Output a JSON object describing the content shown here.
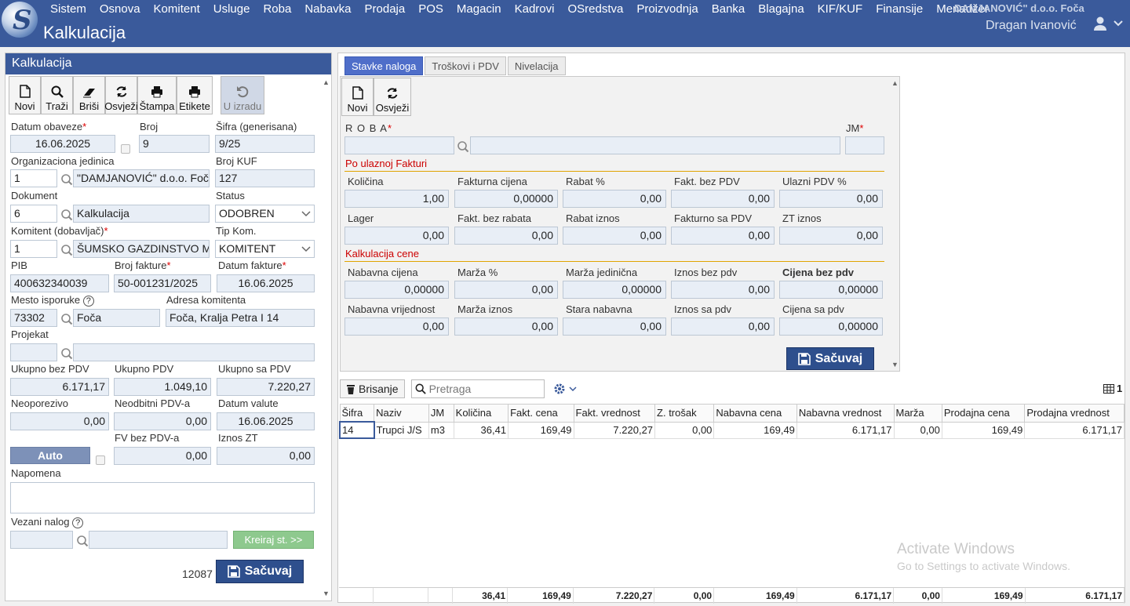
{
  "app": {
    "title": "Kalkulacija",
    "company": "DAMJANOVIĆ\" d.o.o. Foča",
    "user": "Dragan Ivanović"
  },
  "menu": [
    "Sistem",
    "Osnova",
    "Komitent",
    "Usluge",
    "Roba",
    "Nabavka",
    "Prodaja",
    "POS",
    "Magacin",
    "Kadrovi",
    "OSredstva",
    "Proizvodnja",
    "Banka",
    "Blagajna",
    "KIF/KUF",
    "Finansije",
    "Menadžer"
  ],
  "left": {
    "header": "Kalkulacija",
    "toolbar": {
      "novi": "Novi",
      "trazi": "Traži",
      "brisi": "Briši",
      "osvjezi": "Osvježi",
      "stampa": "Štampa",
      "etikete": "Etikete",
      "u_izradu": "U izradu"
    },
    "labels": {
      "datum_obaveze": "Datum obaveze",
      "broj": "Broj",
      "sifra": "Šifra (generisana)",
      "org": "Organizaciona jedinica",
      "broj_kuf": "Broj KUF",
      "dokument": "Dokument",
      "status": "Status",
      "komitent": "Komitent (dobavljač)",
      "tip_kom": "Tip Kom.",
      "pib": "PIB",
      "broj_fakture": "Broj fakture",
      "datum_fakture": "Datum fakture",
      "mesto": "Mesto isporuke",
      "adresa": "Adresa komitenta",
      "projekat": "Projekat",
      "ukupno_bez": "Ukupno bez PDV",
      "ukupno_pdv": "Ukupno PDV",
      "ukupno_sa": "Ukupno sa PDV",
      "neoporezivo": "Neoporezivo",
      "neodbitni": "Neodbitni PDV-a",
      "datum_valute": "Datum valute",
      "fv_bez": "FV bez PDV-a",
      "iznos_zt": "Iznos ZT",
      "napomena": "Napomena",
      "vezani": "Vezani nalog"
    },
    "values": {
      "datum_obaveze": "16.06.2025",
      "broj": "9",
      "sifra": "9/25",
      "org_code": "1",
      "org_name": "\"DAMJANOVIĆ\" d.o.o. Foča",
      "broj_kuf": "127",
      "dok_code": "6",
      "dok_name": "Kalkulacija",
      "status": "ODOBREN",
      "kom_code": "1",
      "kom_name": "ŠUMSKO GAZDINSTVO M",
      "tip_kom": "KOMITENT",
      "pib": "400632340039",
      "broj_fakture": "50-001231/2025",
      "datum_fakture": "16.06.2025",
      "mesto_code": "73302",
      "mesto_name": "Foča",
      "adresa": "Foča, Kralja Petra I 14",
      "ukupno_bez": "6.171,17",
      "ukupno_pdv": "1.049,10",
      "ukupno_sa": "7.220,27",
      "neoporezivo": "0,00",
      "neodbitni": "0,00",
      "datum_valute": "16.06.2025",
      "fv_bez": "0,00",
      "iznos_zt": "0,00"
    },
    "auto": "Auto",
    "kreiraj": "Kreiraj st. >>",
    "id": "12087",
    "sacuvaj": "Sačuvaj"
  },
  "right": {
    "tabs": [
      "Stavke naloga",
      "Troškovi i PDV",
      "Nivelacija"
    ],
    "toolbar": {
      "novi": "Novi",
      "osvjezi": "Osvježi"
    },
    "roba_label": "R O B A",
    "jm_label": "JM",
    "sec1": "Po ulaznoj Fakturi",
    "sec2": "Kalkulacija cene",
    "fields1": [
      {
        "label": "Količina",
        "value": "1,00"
      },
      {
        "label": "Fakturna cijena",
        "value": "0,00000"
      },
      {
        "label": "Rabat %",
        "value": "0,00"
      },
      {
        "label": "Fakt. bez PDV",
        "value": "0,00"
      },
      {
        "label": "Ulazni PDV %",
        "value": "0,00"
      },
      {
        "label": "Lager",
        "value": "0,00"
      },
      {
        "label": "Fakt. bez rabata",
        "value": "0,00"
      },
      {
        "label": "Rabat iznos",
        "value": "0,00"
      },
      {
        "label": "Fakturno sa PDV",
        "value": "0,00"
      },
      {
        "label": "ZT iznos",
        "value": "0,00"
      }
    ],
    "fields2": [
      {
        "label": "Nabavna cijena",
        "value": "0,00000"
      },
      {
        "label": "Marža %",
        "value": "0,00"
      },
      {
        "label": "Marža jedinična",
        "value": "0,00000"
      },
      {
        "label": "Iznos bez pdv",
        "value": "0,00"
      },
      {
        "label": "Cijena bez pdv",
        "value": "0,00000"
      },
      {
        "label": "Nabavna vrijednost",
        "value": "0,00"
      },
      {
        "label": "Marža iznos",
        "value": "0,00"
      },
      {
        "label": "Stara nabavna",
        "value": "0,00"
      },
      {
        "label": "Iznos sa pdv",
        "value": "0,00"
      },
      {
        "label": "Cijena sa pdv",
        "value": "0,00000"
      }
    ],
    "sacuvaj": "Sačuvaj",
    "brisanje": "Brisanje",
    "pretraga": "Pretraga",
    "count": "1",
    "columns": [
      "Šifra",
      "Naziv",
      "JM",
      "Količina",
      "Fakt. cena",
      "Fakt. vrednost",
      "Z. trošak",
      "Nabavna cena",
      "Nabavna vrednost",
      "Marža",
      "Prodajna cena",
      "Prodajna vrednost"
    ],
    "rows": [
      [
        "14",
        "Trupci J/S",
        "m3",
        "36,41",
        "169,49",
        "7.220,27",
        "0,00",
        "169,49",
        "6.171,17",
        "0,00",
        "169,49",
        "6.171,17"
      ]
    ],
    "totals": [
      "",
      "",
      "",
      "36,41",
      "169,49",
      "7.220,27",
      "0,00",
      "169,49",
      "6.171,17",
      "0,00",
      "169,49",
      "6.171,17"
    ]
  },
  "watermark": {
    "line1": "Activate Windows",
    "line2": "Go to Settings to activate Windows."
  }
}
